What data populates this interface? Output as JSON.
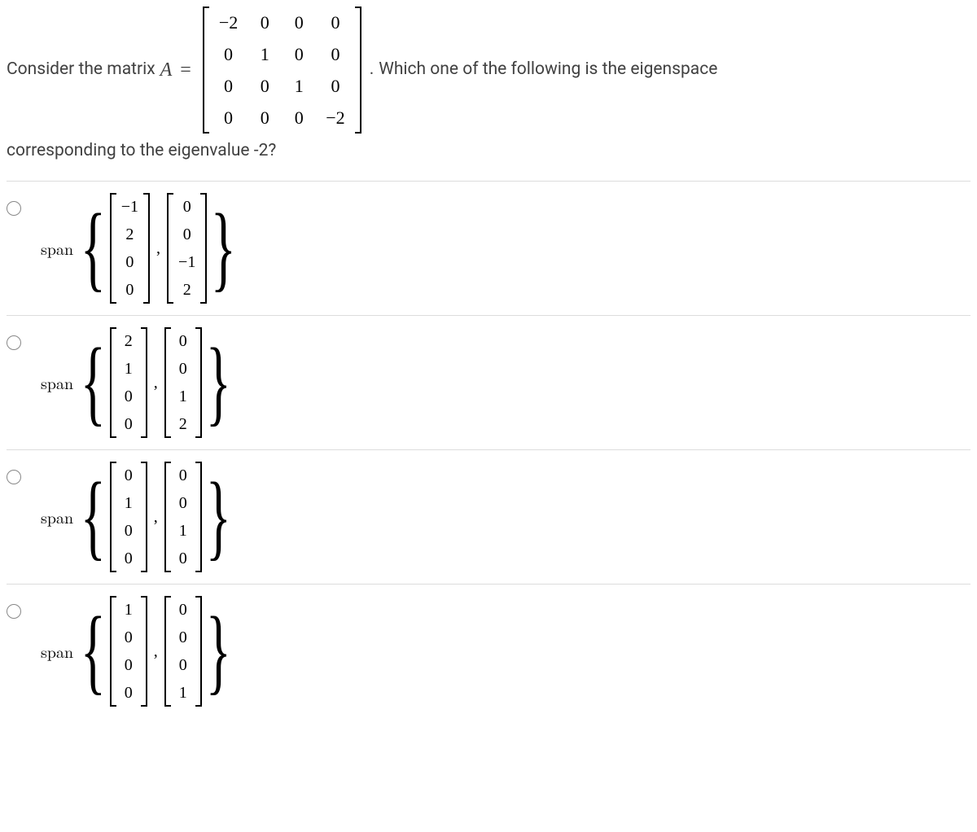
{
  "question": {
    "prefix": "Consider the matrix",
    "var": "A",
    "eq": "=",
    "matrix": [
      [
        "−2",
        "0",
        "0",
        "0"
      ],
      [
        "0",
        "1",
        "0",
        "0"
      ],
      [
        "0",
        "0",
        "1",
        "0"
      ],
      [
        "0",
        "0",
        "0",
        "−2"
      ]
    ],
    "period": ".",
    "rest": "Which one of the following is the eigenspace",
    "line2": "corresponding to the eigenvalue -2?"
  },
  "span_label": "span",
  "comma": ",",
  "options": [
    {
      "v1": [
        "−1",
        "2",
        "0",
        "0"
      ],
      "v2": [
        "0",
        "0",
        "−1",
        "2"
      ]
    },
    {
      "v1": [
        "2",
        "1",
        "0",
        "0"
      ],
      "v2": [
        "0",
        "0",
        "1",
        "2"
      ]
    },
    {
      "v1": [
        "0",
        "1",
        "0",
        "0"
      ],
      "v2": [
        "0",
        "0",
        "1",
        "0"
      ]
    },
    {
      "v1": [
        "1",
        "0",
        "0",
        "0"
      ],
      "v2": [
        "0",
        "0",
        "0",
        "1"
      ]
    }
  ]
}
